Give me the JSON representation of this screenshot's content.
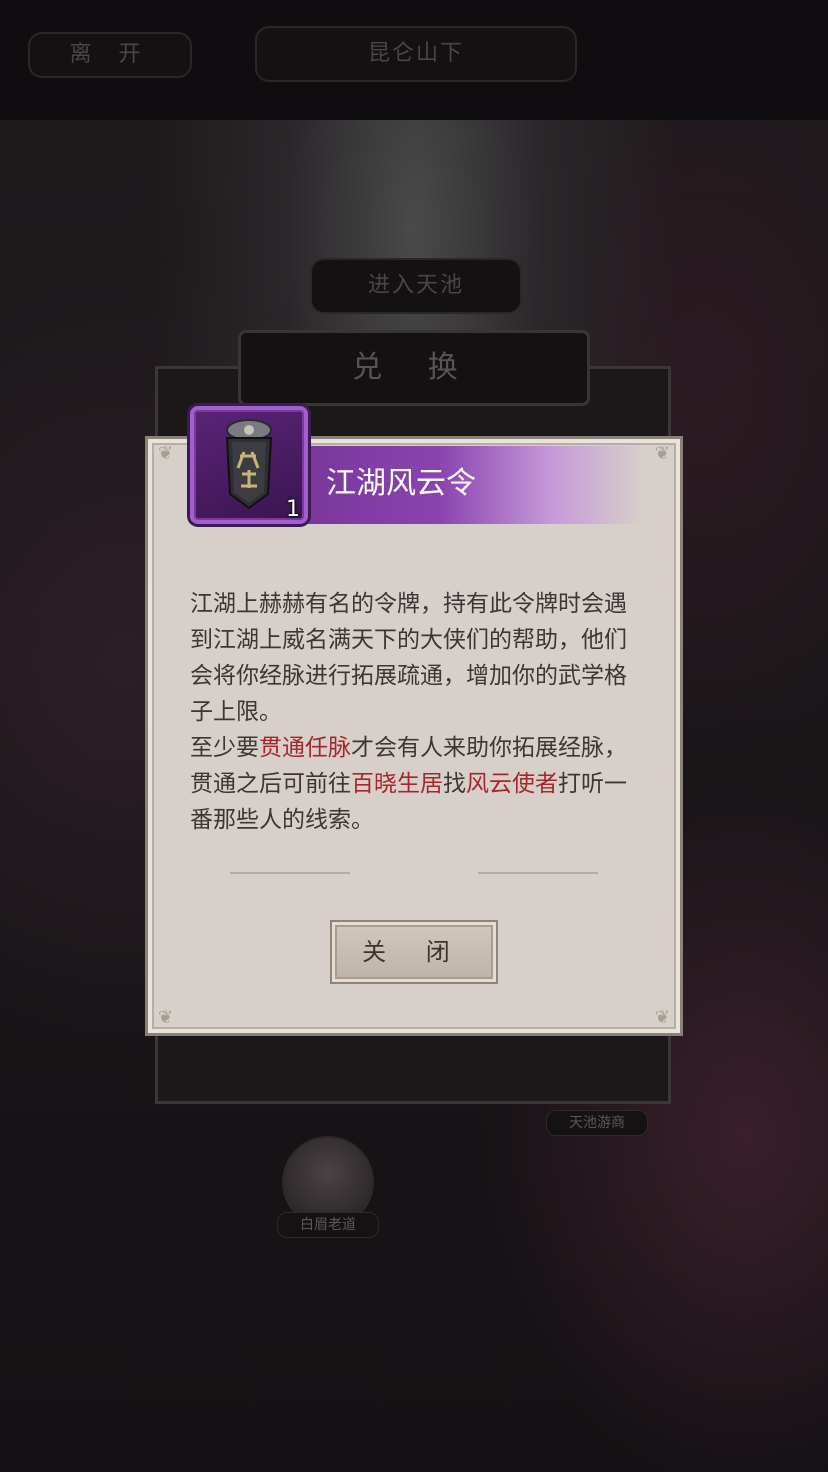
{
  "topbar": {
    "leave_label": "离 开",
    "location_label": "昆仑山下"
  },
  "scene": {
    "enter_pool_label": "进入天池",
    "exchange_title": "兑 换",
    "npc_merchant_label": "天池游商",
    "npc_elder_label": "白眉老道"
  },
  "item": {
    "name": "江湖风云令",
    "count": "1",
    "icon": "token-icon",
    "rarity_color": "#8a44b0"
  },
  "description": {
    "p1": "江湖上赫赫有名的令牌，持有此令牌时会遇到江湖上威名满天下的大侠们的帮助，他们会将你经脉进行拓展疏通，增加你的武学格子上限。",
    "p2_a": "至少要",
    "p2_h1": "贯通任脉",
    "p2_b": "才会有人来助你拓展经脉，贯通之后可前往",
    "p2_h2": "百晓生居",
    "p2_c": "找",
    "p2_h3": "风云使者",
    "p2_d": "打听一番那些人的线索。",
    "highlight_color": "#a5272d"
  },
  "close_label": "关 闭"
}
